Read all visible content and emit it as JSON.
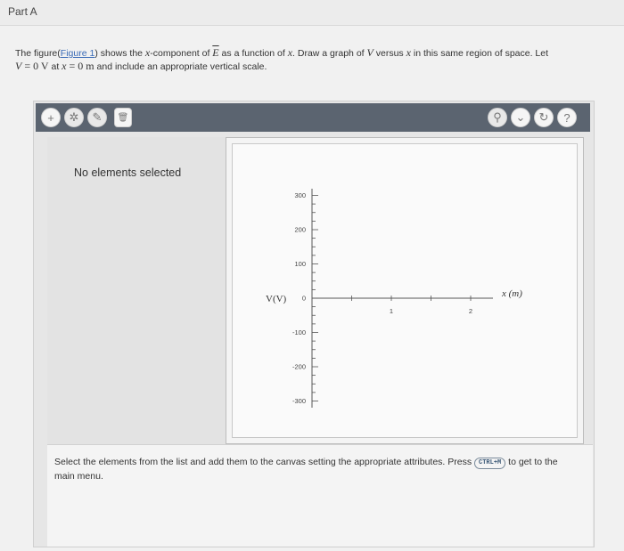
{
  "header": {
    "part_title": "Part A"
  },
  "prompt": {
    "line1_pre": "The figure(",
    "figure_link": "Figure 1",
    "line1_mid": ") shows the ",
    "x_var": "x",
    "line1_mid2": "-component of ",
    "e_var": "E",
    "line1_mid3": " as a function of ",
    "x_var2": "x",
    "line1_mid4": ". Draw a graph of ",
    "v_var": "V",
    "line1_mid5": " versus ",
    "x_var3": "x",
    "line1_post": " in this same region of space. Let",
    "v_var2": "V",
    "eq1": " = 0 V",
    "at_text": " at ",
    "x_var4": "x",
    "eq2": " = 0 m",
    "line2_post": " and include an appropriate vertical scale."
  },
  "toolbar": {
    "add_icon": "+",
    "vector_icon": "✲",
    "draw_icon": "✎",
    "trash_icon": "🗑",
    "hint_icon": "⚲",
    "chevron_icon": "⌄",
    "reset_icon": "↻",
    "help_icon": "?"
  },
  "side_panel": {
    "empty_text": "No elements selected"
  },
  "graph": {
    "y_axis_title": "V(V)",
    "x_axis_title": "x (m)",
    "y_tick_labels": [
      "300",
      "200",
      "100",
      "0",
      "-100",
      "-200",
      "-300"
    ],
    "x_tick_labels": [
      "1",
      "2"
    ],
    "axis_color": "#555555"
  },
  "instructions": {
    "text_pre": "Select the elements from the list and add them to the canvas setting the appropriate attributes. Press ",
    "shortcut": "CTRL+M",
    "text_post": " to get to the main menu."
  }
}
